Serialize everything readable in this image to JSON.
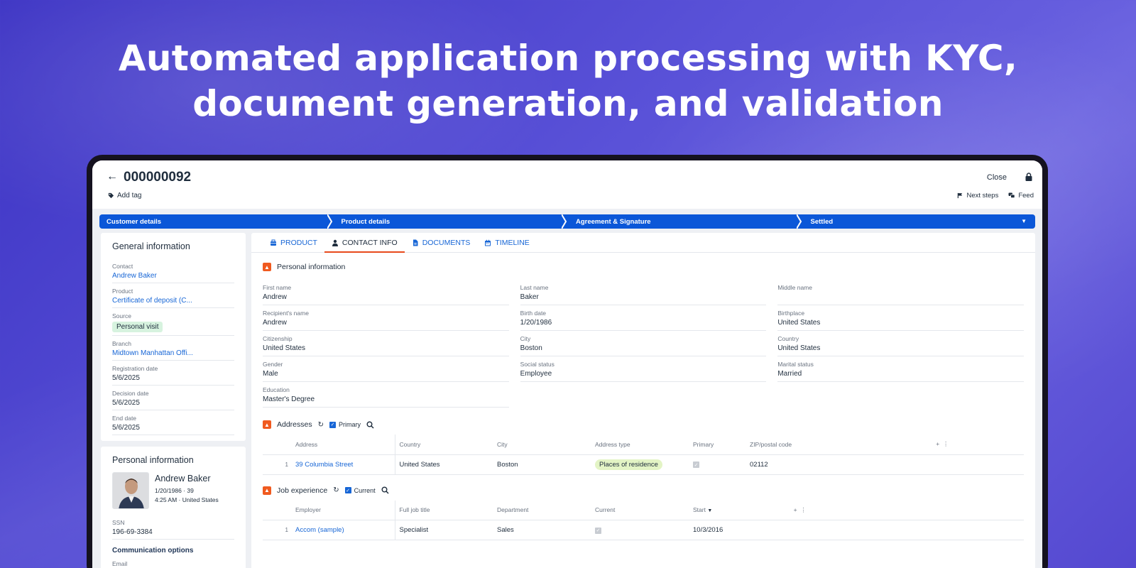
{
  "headline": {
    "line1": "Automated application processing with KYC,",
    "line2": "document generation, and validation"
  },
  "header": {
    "record_id": "000000092",
    "add_tag": "Add tag",
    "close": "Close",
    "next_steps": "Next steps",
    "feed": "Feed"
  },
  "stages": [
    "Customer details",
    "Product details",
    "Agreement & Signature",
    "Settled"
  ],
  "general": {
    "title": "General information",
    "fields": [
      {
        "label": "Contact",
        "value": "Andrew Baker"
      },
      {
        "label": "Product",
        "value": "Certificate of deposit (C..."
      },
      {
        "label": "Source",
        "value": "Personal visit"
      },
      {
        "label": "Branch",
        "value": "Midtown Manhattan Offi..."
      },
      {
        "label": "Registration date",
        "value": "5/6/2025"
      },
      {
        "label": "Decision date",
        "value": "5/6/2025"
      },
      {
        "label": "End date",
        "value": "5/6/2025"
      }
    ]
  },
  "person_card": {
    "title": "Personal information",
    "name": "Andrew Baker",
    "dob_age": "1/20/1986 · 39",
    "time_country": "4:25 AM · United States",
    "ssn_label": "SSN",
    "ssn": "196-69-3384",
    "comm": "Communication options",
    "email_label": "Email"
  },
  "tabs": [
    {
      "label": "PRODUCT",
      "icon": "product-icon"
    },
    {
      "label": "CONTACT INFO",
      "icon": "person-icon"
    },
    {
      "label": "DOCUMENTS",
      "icon": "document-icon"
    },
    {
      "label": "TIMELINE",
      "icon": "calendar-icon"
    }
  ],
  "personal": {
    "title": "Personal information",
    "fields": [
      {
        "label": "First name",
        "value": "Andrew"
      },
      {
        "label": "Last name",
        "value": "Baker"
      },
      {
        "label": "Middle name",
        "value": ""
      },
      {
        "label": "Recipient's name",
        "value": "Andrew"
      },
      {
        "label": "Birth date",
        "value": "1/20/1986"
      },
      {
        "label": "Birthplace",
        "value": "United States"
      },
      {
        "label": "Citizenship",
        "value": "United States"
      },
      {
        "label": "City",
        "value": "Boston"
      },
      {
        "label": "Country",
        "value": "United States"
      },
      {
        "label": "Gender",
        "value": "Male"
      },
      {
        "label": "Social status",
        "value": "Employee"
      },
      {
        "label": "Marital status",
        "value": "Married"
      },
      {
        "label": "Education",
        "value": "Master's Degree"
      }
    ]
  },
  "addresses": {
    "title": "Addresses",
    "filter": "Primary",
    "columns": [
      "Address",
      "Country",
      "City",
      "Address type",
      "Primary",
      "ZIP/postal code"
    ],
    "rows": [
      {
        "num": "1",
        "address": "39 Columbia Street",
        "country": "United States",
        "city": "Boston",
        "type": "Places of residence",
        "zip": "02112"
      }
    ]
  },
  "jobs": {
    "title": "Job experience",
    "filter": "Current",
    "columns": [
      "Employer",
      "Full job title",
      "Department",
      "Current",
      "Start"
    ],
    "rows": [
      {
        "num": "1",
        "employer": "Accom (sample)",
        "title": "Specialist",
        "department": "Sales",
        "start": "10/3/2016"
      }
    ]
  }
}
